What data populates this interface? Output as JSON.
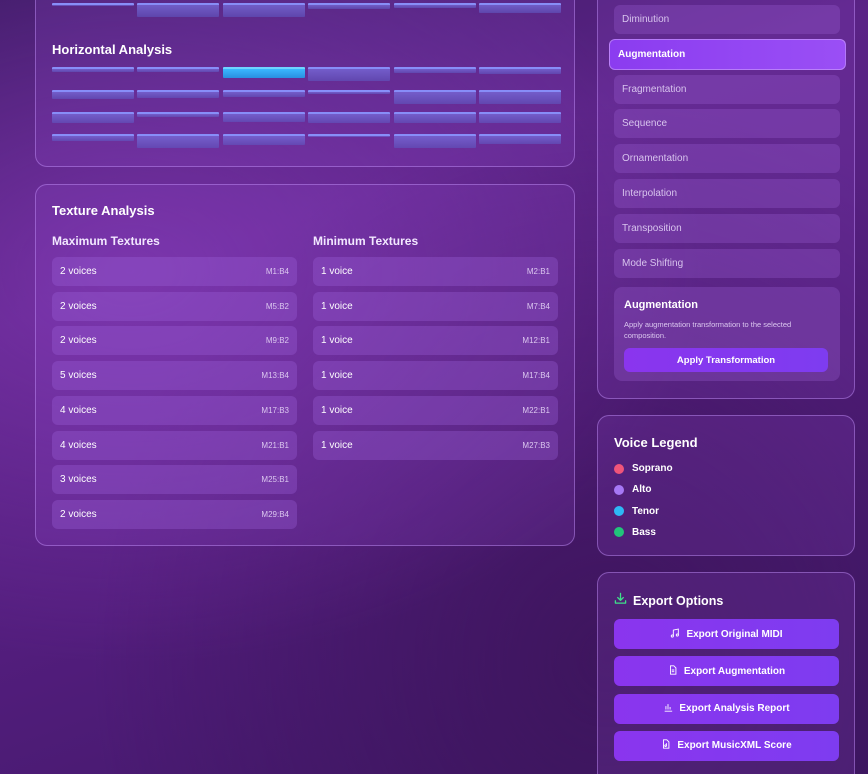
{
  "horizontal_analysis": {
    "title": "Horizontal Analysis",
    "columns": 6,
    "rows": [
      {
        "levels": [
          0.15,
          0.8,
          0.75,
          0.35,
          0.25,
          0.55
        ]
      },
      {
        "levels": [
          0.25,
          0.25,
          0.6,
          0.75,
          0.35,
          0.4
        ]
      },
      {
        "levels": [
          0.5,
          0.45,
          0.4,
          0.2,
          0.8,
          0.8
        ]
      },
      {
        "levels": [
          0.6,
          0.25,
          0.55,
          0.6,
          0.6,
          0.6
        ]
      },
      {
        "levels": [
          0.4,
          0.8,
          0.6,
          0.15,
          0.75,
          0.55
        ]
      }
    ],
    "highlight": {
      "row": 1,
      "col": 2
    }
  },
  "texture_analysis": {
    "title": "Texture Analysis",
    "max_title": "Maximum Textures",
    "min_title": "Minimum Textures",
    "max": [
      {
        "label": "2 voices",
        "pos": "M1:B4"
      },
      {
        "label": "2 voices",
        "pos": "M5:B2"
      },
      {
        "label": "2 voices",
        "pos": "M9:B2"
      },
      {
        "label": "5 voices",
        "pos": "M13:B4"
      },
      {
        "label": "4 voices",
        "pos": "M17:B3"
      },
      {
        "label": "4 voices",
        "pos": "M21:B1"
      },
      {
        "label": "3 voices",
        "pos": "M25:B1"
      },
      {
        "label": "2 voices",
        "pos": "M29:B4"
      }
    ],
    "min": [
      {
        "label": "1 voice",
        "pos": "M2:B1"
      },
      {
        "label": "1 voice",
        "pos": "M7:B4"
      },
      {
        "label": "1 voice",
        "pos": "M12:B1"
      },
      {
        "label": "1 voice",
        "pos": "M17:B4"
      },
      {
        "label": "1 voice",
        "pos": "M22:B1"
      },
      {
        "label": "1 voice",
        "pos": "M27:B3"
      }
    ]
  },
  "transformations": {
    "items": [
      "Diminution",
      "Augmentation",
      "Fragmentation",
      "Sequence",
      "Ornamentation",
      "Interpolation",
      "Transposition",
      "Mode Shifting"
    ],
    "active": "Augmentation",
    "detail_title": "Augmentation",
    "detail_desc": "Apply augmentation transformation to the selected composition.",
    "apply_label": "Apply Transformation"
  },
  "legend": {
    "title": "Voice Legend",
    "voices": [
      {
        "name": "Soprano",
        "color": "#f0557a"
      },
      {
        "name": "Alto",
        "color": "#a678f5"
      },
      {
        "name": "Tenor",
        "color": "#2eb8f5"
      },
      {
        "name": "Bass",
        "color": "#22c47a"
      }
    ]
  },
  "export": {
    "title": "Export Options",
    "title_icon": "download-icon",
    "buttons": [
      {
        "label": "Export Original MIDI",
        "icon": "music-note-icon"
      },
      {
        "label": "Export Augmentation",
        "icon": "document-icon"
      },
      {
        "label": "Export Analysis Report",
        "icon": "bar-chart-icon"
      },
      {
        "label": "Export MusicXML Score",
        "icon": "score-file-icon"
      }
    ]
  }
}
